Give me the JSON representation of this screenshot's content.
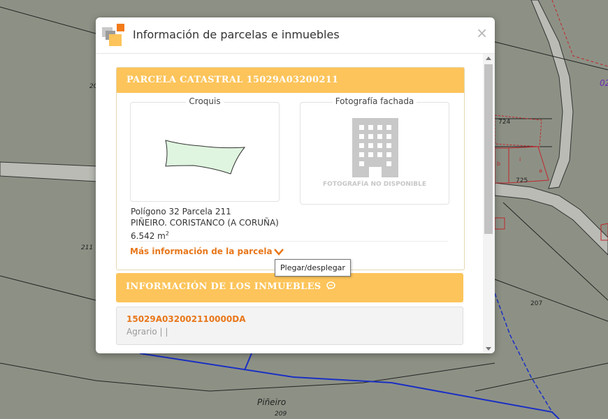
{
  "map": {
    "labels": {
      "l_20": "20",
      "l_02": "02",
      "l_724": "724",
      "l_725": "725",
      "l_211": "211",
      "l_207": "207",
      "l_pineiro": "Piñeiro",
      "l_209": "209",
      "l_b": "b",
      "l_a": "a",
      "l_i": "i"
    }
  },
  "modal": {
    "title": "Información de parcelas e inmuebles",
    "close_symbol": "×"
  },
  "parcel": {
    "header": "PARCELA CATASTRAL 15029A03200211",
    "sketch_title": "Croquis",
    "photo_title": "Fotografía fachada",
    "photo_placeholder": "FOTOGRAFÍA NO DISPONIBLE",
    "location_line": "Polígono 32 Parcela 211",
    "municipality_line": "PIÑEIRO. CORISTANCO (A CORUÑA)",
    "area_value": "6.542 m",
    "area_unit_sup": "2",
    "more_info_link": "Más información de la parcela"
  },
  "properties": {
    "header": "INFORMACIÓN DE LOS INMUEBLES",
    "items": [
      {
        "reference": "15029A032002110000DA",
        "usage": "Agrario | |"
      }
    ]
  },
  "tooltip": {
    "text": "Plegar/desplegar"
  },
  "colors": {
    "panel_header": "#fcc45a",
    "link_orange": "#e8771b",
    "map_background": "#8d9185"
  }
}
